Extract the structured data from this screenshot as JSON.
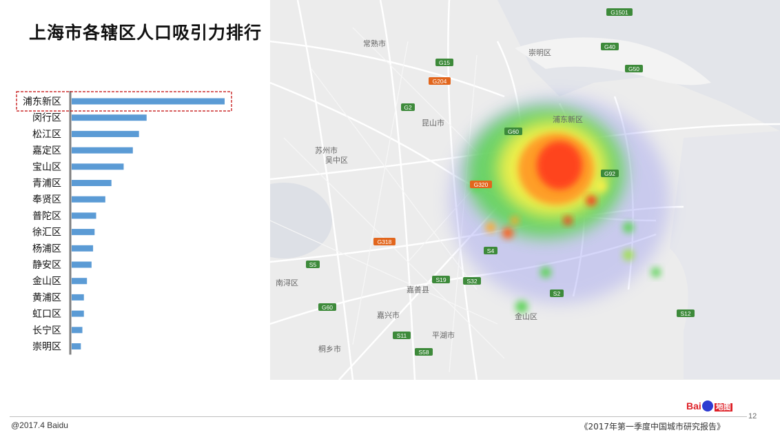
{
  "page": {
    "title": "上海市各辖区人口吸引力排行",
    "footer_left": "@2017.4 Baidu",
    "footer_right": "《2017年第一季度中国城市研究报告》",
    "page_number": "12",
    "logo": {
      "brand": "Bai",
      "brand_du": "du",
      "suffix": "地图"
    }
  },
  "colors": {
    "bar": "#5b9bd5",
    "axis": "#7f7f7f",
    "highlight_box": "#c00000",
    "map_bg": "#ececec",
    "road": "#ffffff",
    "river": "#c9cdd6"
  },
  "chart_data": {
    "type": "bar",
    "orientation": "horizontal",
    "title": "",
    "xlabel": "",
    "ylabel": "",
    "categories": [
      "浦东新区",
      "闵行区",
      "松江区",
      "嘉定区",
      "宝山区",
      "青浦区",
      "奉贤区",
      "普陀区",
      "徐汇区",
      "杨浦区",
      "静安区",
      "金山区",
      "黄浦区",
      "虹口区",
      "长宁区",
      "崇明区"
    ],
    "values": [
      100,
      49,
      44,
      40,
      34,
      26,
      22,
      16,
      15,
      14,
      13,
      10,
      8,
      8,
      7,
      6
    ],
    "highlighted": "浦东新区",
    "xlim": [
      0,
      100
    ],
    "value_unit": "relative index (no axis printed)"
  },
  "map": {
    "place_labels": [
      "常熟市",
      "苏州市",
      "吴中区",
      "昆山市",
      "嘉善县",
      "嘉兴市",
      "平湖市",
      "南浔区",
      "桐乡市",
      "崇明区",
      "浦东新区",
      "金山区"
    ],
    "highway_labels": [
      "G15",
      "G2",
      "G204",
      "G40",
      "G1501",
      "G50",
      "G60",
      "G92",
      "G320",
      "G318",
      "S5",
      "S19",
      "S32",
      "S4",
      "S2",
      "S12",
      "G60",
      "S11",
      "S58"
    ],
    "heatmap_legend": "population density heat"
  }
}
